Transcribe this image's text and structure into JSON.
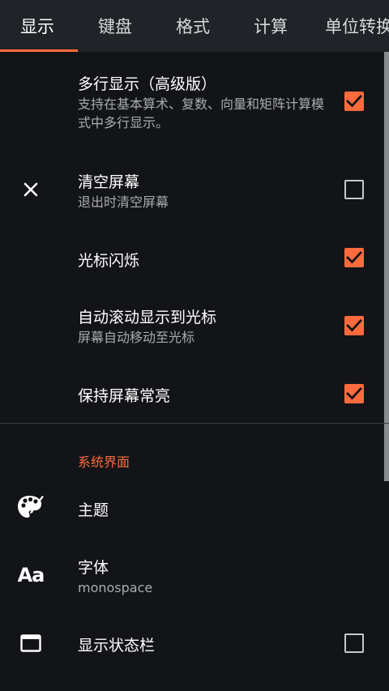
{
  "tabs": [
    {
      "label": "显示",
      "active": true
    },
    {
      "label": "键盘",
      "active": false
    },
    {
      "label": "格式",
      "active": false
    },
    {
      "label": "计算",
      "active": false
    },
    {
      "label": "单位转换",
      "active": false
    }
  ],
  "accent_color": "#ff6b3d",
  "settings": [
    {
      "title": "多行显示（高级版）",
      "summary": "支持在基本算术、复数、向量和矩阵计算模式中多行显示。",
      "checked": true
    },
    {
      "title": "清空屏幕",
      "summary": "退出时清空屏幕",
      "checked": false,
      "icon": "close-icon"
    },
    {
      "title": "光标闪烁",
      "checked": true
    },
    {
      "title": "自动滚动显示到光标",
      "summary": "屏幕自动移动至光标",
      "checked": true
    },
    {
      "title": "保持屏幕常亮",
      "checked": true
    }
  ],
  "system_ui": {
    "category_label": "系统界面",
    "theme": {
      "title": "主题",
      "icon": "palette-icon"
    },
    "font": {
      "title": "字体",
      "summary": "monospace",
      "icon_text": "Aa",
      "icon": "font-icon"
    },
    "status_bar": {
      "title": "显示状态栏",
      "checked": false,
      "icon": "window-icon"
    }
  }
}
